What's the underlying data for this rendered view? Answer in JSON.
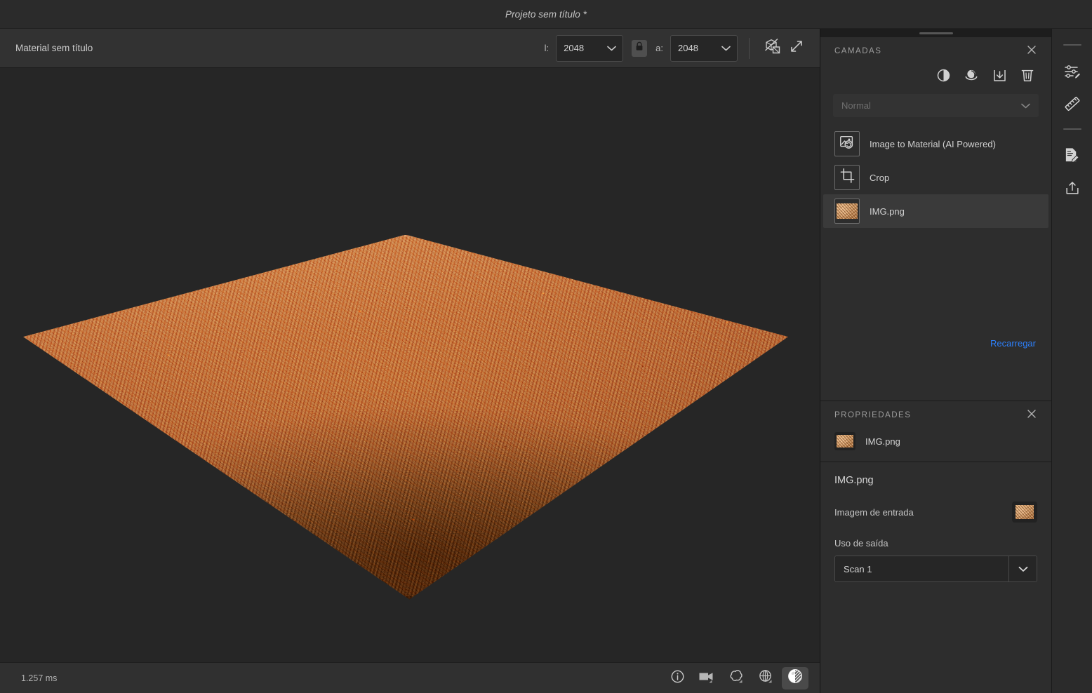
{
  "titlebar": {
    "project_name": "Projeto sem título *"
  },
  "material_toolbar": {
    "material_name": "Material sem título",
    "width_label": "l:",
    "width_value": "2048",
    "height_label": "a:",
    "height_value": "2048",
    "lock_icon": "lock-icon",
    "toggle_2d_3d_icon": "toggle-2d-3d-icon",
    "fullscreen_icon": "expand-arrows-icon"
  },
  "viewport": {
    "status_time": "1.257 ms",
    "view_buttons": [
      {
        "name": "info-icon",
        "label": "Informações",
        "active": false
      },
      {
        "name": "camera-icon",
        "label": "Câmera",
        "active": false
      },
      {
        "name": "environment-icon",
        "label": "Ambiente",
        "active": false
      },
      {
        "name": "globe-icon",
        "label": "Projeção",
        "active": false
      },
      {
        "name": "material-sphere-icon",
        "label": "Material",
        "active": true
      }
    ]
  },
  "layers_panel": {
    "title": "CAMADAS",
    "close_icon": "close-icon",
    "tools": [
      {
        "name": "adjustment-layer-icon",
        "label": "Camada de ajuste"
      },
      {
        "name": "filter-layer-icon",
        "label": "Camada de filtro"
      },
      {
        "name": "import-layer-icon",
        "label": "Importar"
      },
      {
        "name": "delete-layer-icon",
        "label": "Excluir"
      }
    ],
    "blend_mode": "Normal",
    "layers": [
      {
        "name": "Image to Material (AI Powered)",
        "icon": "image-to-material-icon",
        "selected": false
      },
      {
        "name": "Crop",
        "icon": "crop-icon",
        "selected": false
      },
      {
        "name": "IMG.png",
        "icon": "texture-thumbnail",
        "selected": true
      }
    ],
    "reload_label": "Recarregar"
  },
  "properties_panel": {
    "title": "PROPRIEDADES",
    "close_icon": "close-icon",
    "header_item": "IMG.png",
    "section_title": "IMG.png",
    "input_image_label": "Imagem de entrada",
    "output_usage_label": "Uso de saída",
    "output_usage_value": "Scan 1"
  },
  "right_rail": {
    "items": [
      {
        "name": "properties-adjust-icon",
        "label": "Propriedades"
      },
      {
        "name": "ruler-icon",
        "label": "Escala física"
      },
      {
        "name": "document-edit-icon",
        "label": "Anotações"
      },
      {
        "name": "export-icon",
        "label": "Exportar"
      }
    ]
  },
  "colors": {
    "accent_link": "#2d7ff9",
    "panel_bg": "#2d2d2d",
    "app_bg": "#1d1d1d",
    "viewport_bg": "#262626",
    "toolbar_bg": "#323232"
  }
}
